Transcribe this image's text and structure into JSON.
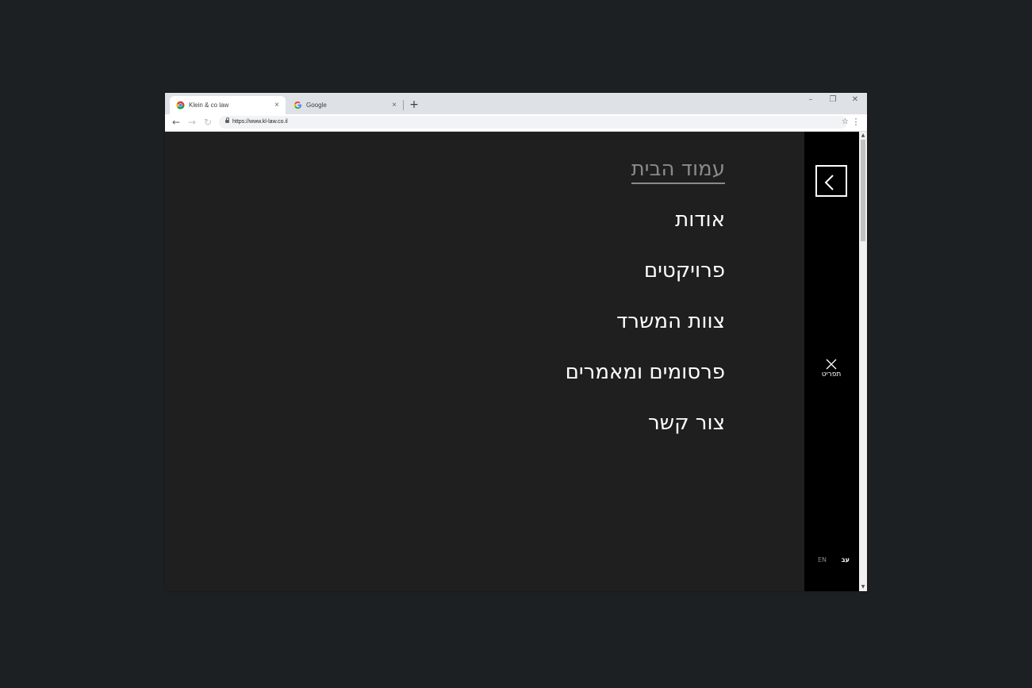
{
  "browser": {
    "tabs": [
      {
        "title": "Klein & co law",
        "favicon": "chrome-icon",
        "close": "×"
      },
      {
        "title": "Google",
        "favicon": "google-g-icon",
        "close": "×"
      }
    ],
    "new_tab": "+",
    "window_controls": {
      "minimize": "–",
      "maximize": "❐",
      "close": "✕"
    },
    "nav": {
      "back": "←",
      "forward": "→",
      "reload": "↻"
    },
    "url": "https://www.kl-law.co.il",
    "bookmark": "☆",
    "menu": "⋮"
  },
  "site": {
    "menu_items": [
      {
        "label": "עמוד הבית",
        "current": true
      },
      {
        "label": "אודות",
        "current": false
      },
      {
        "label": "פרויקטים",
        "current": false
      },
      {
        "label": "צוות המשרד",
        "current": false
      },
      {
        "label": "פרסומים ומאמרים",
        "current": false
      },
      {
        "label": "צור קשר",
        "current": false
      }
    ],
    "close_label": "תפריט",
    "lang_en": "EN",
    "lang_he": "עב"
  },
  "colors": {
    "page_bg": "#1f1f1f",
    "sidebar_bg": "#000000",
    "menu_text": "#ffffff",
    "current_item": "#8a8a8a"
  }
}
